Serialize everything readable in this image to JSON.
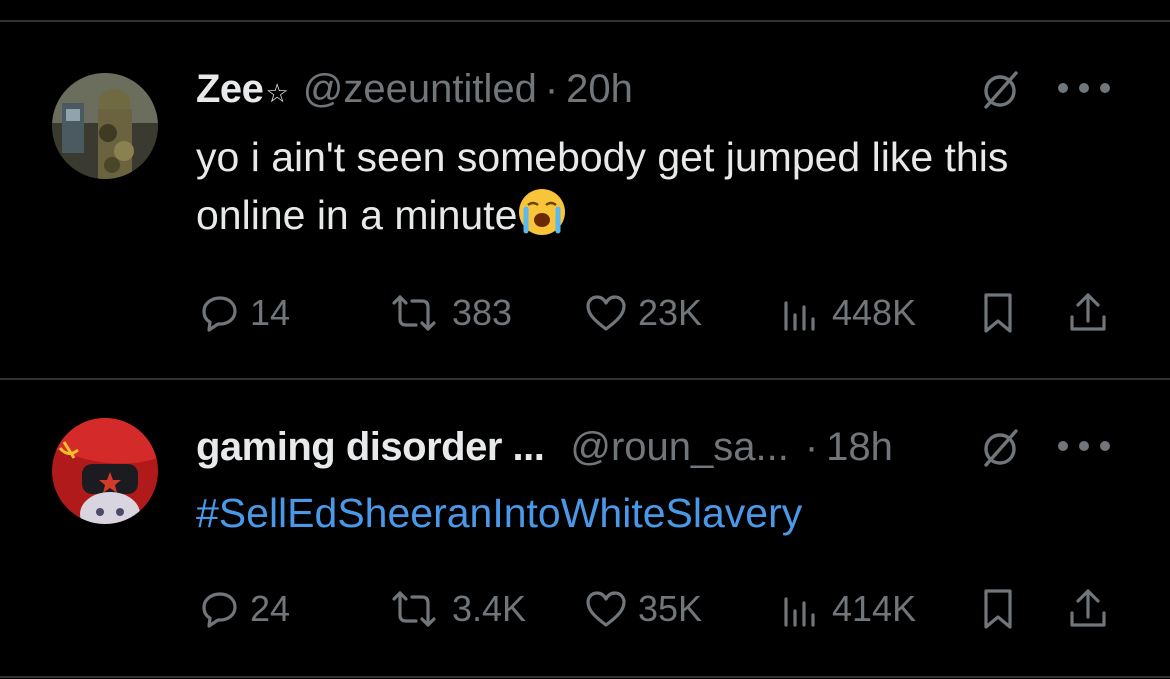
{
  "tweets": [
    {
      "name": "Zee",
      "handle": "@zeeuntitled",
      "separator": "·",
      "time": "20h",
      "text": "yo i ain't seen somebody get jumped like this online in a minute",
      "emoji": "loudly-crying-face",
      "stats": {
        "replies": "14",
        "reposts": "383",
        "likes": "23K",
        "views": "448K"
      }
    },
    {
      "name": "gaming disorder ...",
      "handle": "@roun_sa...",
      "separator": "·",
      "time": "18h",
      "text": "#SellEdSheeranIntoWhiteSlavery",
      "stats": {
        "replies": "24",
        "reposts": "3.4K",
        "likes": "35K",
        "views": "414K"
      }
    }
  ],
  "icons": [
    "reply-icon",
    "repost-icon",
    "like-icon",
    "views-icon",
    "bookmark-icon",
    "share-icon",
    "grok-slash-icon",
    "more-icon",
    "verified-star-icon"
  ],
  "colors": {
    "background": "#000000",
    "text": "#e7e9ea",
    "muted": "#71767b",
    "hashtag": "#4a98e8",
    "divider": "#2f3336"
  }
}
